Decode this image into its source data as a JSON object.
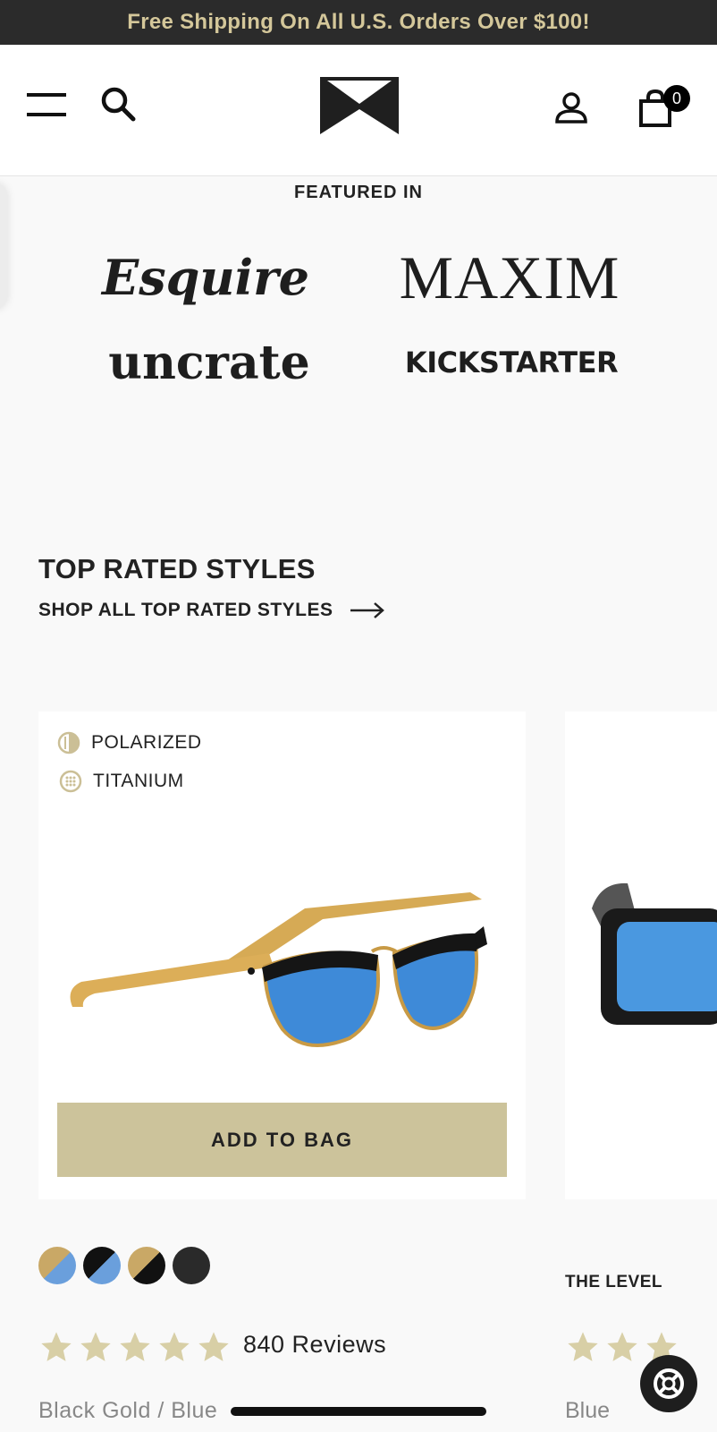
{
  "promo": {
    "text": "Free Shipping On All U.S. Orders Over $100!"
  },
  "header": {
    "cart_count": "0"
  },
  "featured": {
    "title": "FEATURED IN",
    "logos": [
      "Esquire",
      "MAXIM",
      "uncrate",
      "KICKSTARTER"
    ]
  },
  "top_rated": {
    "title": "TOP RATED STYLES",
    "shop_all": "SHOP ALL TOP RATED STYLES"
  },
  "product": {
    "features": [
      "POLARIZED",
      "TITANIUM"
    ],
    "add_to_bag": "ADD TO BAG",
    "swatches": [
      {
        "name": "gold-blue",
        "colors": [
          "#c9a866",
          "#6a9fdc"
        ]
      },
      {
        "name": "black-blue",
        "colors": [
          "#111111",
          "#6a9fdc"
        ]
      },
      {
        "name": "gold-black",
        "colors": [
          "#c9a866",
          "#111111"
        ]
      },
      {
        "name": "black",
        "colors": [
          "#2a2a2a",
          "#2a2a2a"
        ]
      }
    ],
    "rating": 5,
    "reviews": "840 Reviews",
    "variant": "Black Gold / Blue"
  },
  "product2": {
    "name": "THE LEVEL",
    "variant": "Blue"
  },
  "colors": {
    "promo_bg": "#2b2b2b",
    "promo_text": "#d4c79a",
    "accent": "#ccc39b",
    "star": "#d8cfa6"
  }
}
